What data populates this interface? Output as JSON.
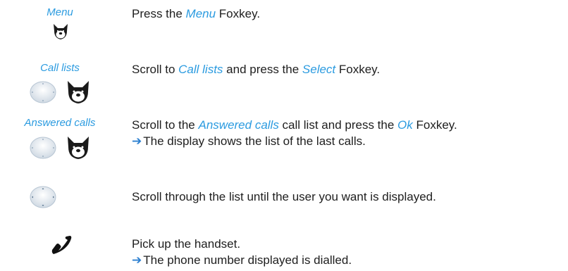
{
  "steps": [
    {
      "label": "Menu",
      "text": [
        {
          "t": "Press the ",
          "hl": false
        },
        {
          "t": "Menu",
          "hl": true
        },
        {
          "t": " Foxkey.",
          "hl": false
        }
      ]
    },
    {
      "label": "Call lists",
      "text": [
        {
          "t": "Scroll to ",
          "hl": false
        },
        {
          "t": "Call lists",
          "hl": true
        },
        {
          "t": " and press the ",
          "hl": false
        },
        {
          "t": "Select",
          "hl": true
        },
        {
          "t": " Foxkey.",
          "hl": false
        }
      ]
    },
    {
      "label": "Answered calls",
      "text": [
        {
          "t": "Scroll to the ",
          "hl": false
        },
        {
          "t": "Answered calls",
          "hl": true
        },
        {
          "t": " call list and press the ",
          "hl": false
        },
        {
          "t": "Ok",
          "hl": true
        },
        {
          "t": " Foxkey.",
          "hl": false
        }
      ],
      "result": "The display shows the list of the last calls."
    },
    {
      "label": "",
      "text": [
        {
          "t": "Scroll through the list until the user you want is displayed.",
          "hl": false
        }
      ]
    },
    {
      "label": "",
      "text": [
        {
          "t": "Pick up the handset.",
          "hl": false
        }
      ],
      "result": "The phone number displayed is dialled."
    }
  ],
  "arrow_glyph": "➔",
  "colors": {
    "highlight": "#2b9be0",
    "text": "#1e1e1e"
  },
  "icons": {
    "foxkey": "fox-head-icon",
    "navigation": "navigation-key-icon",
    "handset": "handset-icon"
  }
}
